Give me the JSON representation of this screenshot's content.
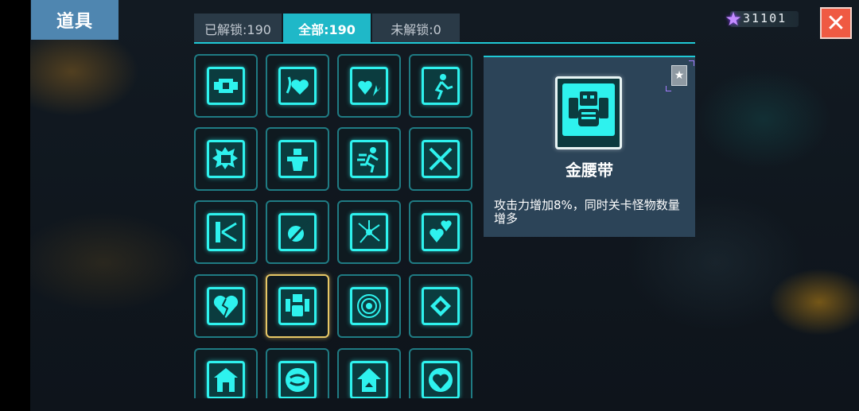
{
  "title": "道具",
  "tabs": [
    {
      "label": "已解锁:190"
    },
    {
      "label": "全部:190",
      "active": true
    },
    {
      "label": "未解锁:0"
    }
  ],
  "currency": {
    "amount": "31101",
    "icon": "star-gem-icon"
  },
  "close_label": "✕",
  "selected": {
    "name": "金腰带",
    "description": "攻击力增加8%，同时关卡怪物数量增多",
    "icon": "gold-belt-icon",
    "badge_icon": "star-badge-icon",
    "badge_symbol": "★"
  },
  "items": [
    {
      "icon": "puzzle-block-icon"
    },
    {
      "icon": "heart-curl-icon"
    },
    {
      "icon": "heart-burst-icon"
    },
    {
      "icon": "running-man-icon"
    },
    {
      "icon": "fist-burst-icon"
    },
    {
      "icon": "muscle-man-icon"
    },
    {
      "icon": "sprint-icon"
    },
    {
      "icon": "crossed-swords-icon"
    },
    {
      "icon": "flag-arrow-icon"
    },
    {
      "icon": "sword-ball-icon"
    },
    {
      "icon": "star-network-icon"
    },
    {
      "icon": "double-heart-icon"
    },
    {
      "icon": "broken-heart-icon"
    },
    {
      "icon": "gold-belt-icon",
      "selected": true
    },
    {
      "icon": "target-rings-icon"
    },
    {
      "icon": "diamond-arrows-icon"
    },
    {
      "icon": "house-icon"
    },
    {
      "icon": "swirl-icon"
    },
    {
      "icon": "home-up-icon"
    },
    {
      "icon": "shield-heart-icon"
    }
  ],
  "colors": {
    "accent": "#1fc9d6",
    "neon": "#2ef2ee",
    "selected_border": "#e7c766",
    "close": "#ef5a43"
  }
}
